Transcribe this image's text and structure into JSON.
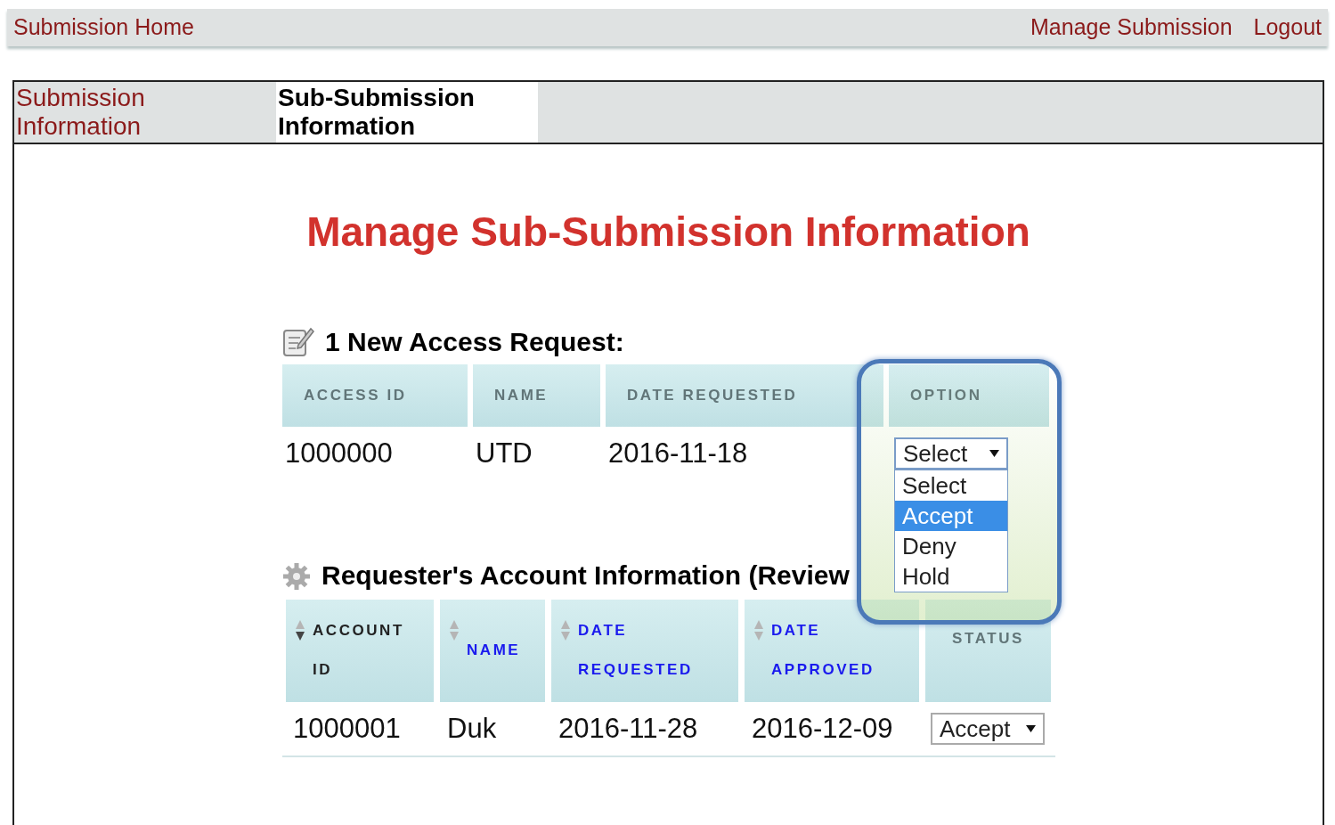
{
  "top_nav": {
    "home": "Submission Home",
    "links": [
      "Manage Submission",
      "Logout"
    ]
  },
  "tabs": [
    {
      "label": "Submission Information",
      "selected": false
    },
    {
      "label": "Sub-Submission Information",
      "selected": true
    }
  ],
  "title": "Manage Sub-Submission Information",
  "access_requests": {
    "heading": "1 New Access Request:",
    "columns": [
      "ACCESS ID",
      "NAME",
      "DATE REQUESTED",
      "OPTION"
    ],
    "rows": [
      {
        "cells": [
          "1000000",
          "UTD",
          "2016-11-18"
        ],
        "option": {
          "value": "Select",
          "expanded": true,
          "options": [
            {
              "label": "Select",
              "highlighted": false
            },
            {
              "label": "Accept",
              "highlighted": true
            },
            {
              "label": "Deny",
              "highlighted": false
            },
            {
              "label": "Hold",
              "highlighted": false
            }
          ]
        }
      }
    ]
  },
  "account_info": {
    "heading": "Requester's Account Information (Review",
    "columns": [
      {
        "label": "ACCOUNT ID",
        "sortable": true,
        "sorted": true
      },
      {
        "label": "NAME",
        "sortable": true,
        "sorted": false
      },
      {
        "label": "DATE REQUESTED",
        "sortable": true,
        "sorted": false
      },
      {
        "label": "DATE APPROVED",
        "sortable": true,
        "sorted": false
      },
      {
        "label": "STATUS",
        "sortable": false
      }
    ],
    "rows": [
      {
        "cells": [
          "1000001",
          "Duk",
          "2016-11-28",
          "2016-12-09"
        ],
        "status": {
          "value": "Accept",
          "expanded": false
        }
      }
    ]
  }
}
